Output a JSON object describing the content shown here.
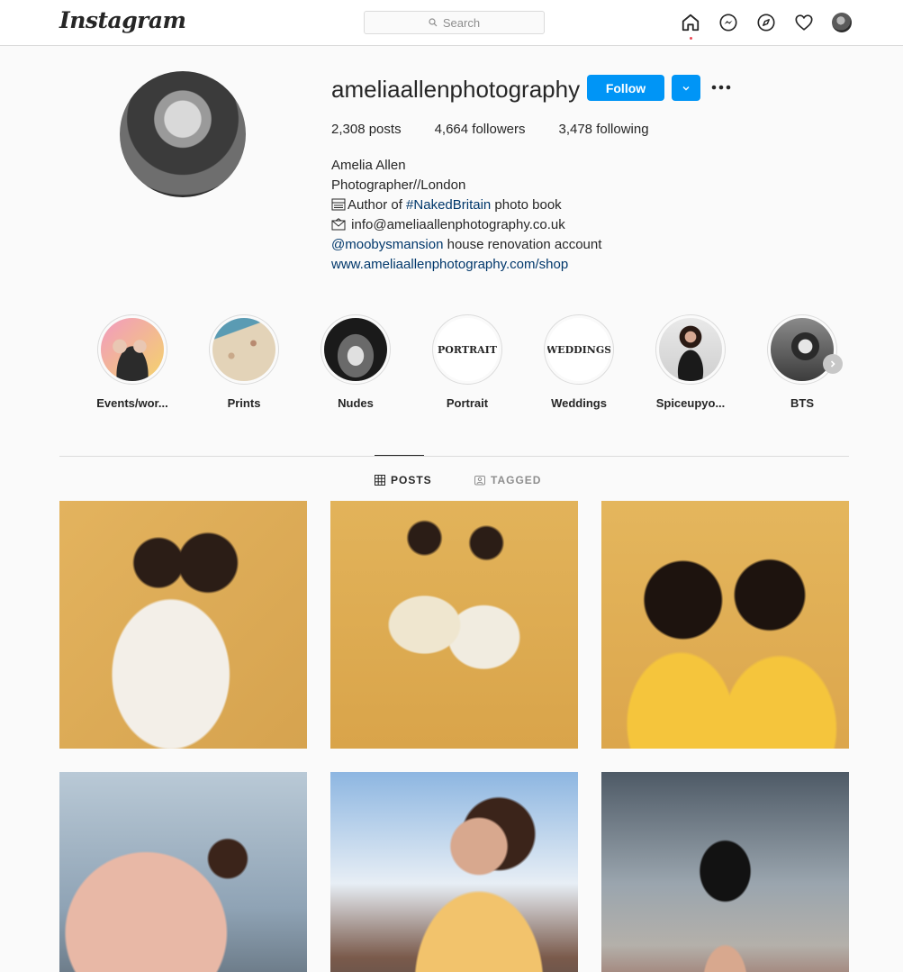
{
  "app": {
    "logo": "Instagram"
  },
  "search": {
    "placeholder": "Search"
  },
  "profile": {
    "username": "ameliaallenphotography",
    "follow_label": "Follow",
    "stats": {
      "posts": "2,308",
      "posts_label": "posts",
      "followers": "4,664",
      "followers_label": "followers",
      "following": "3,478",
      "following_label": "following"
    },
    "full_name": "Amelia Allen",
    "bio_line1": "Photographer//London",
    "bio_line2_prefix": "Author of ",
    "bio_line2_tag": "#NakedBritain",
    "bio_line2_suffix": " photo book",
    "bio_line3": "info@ameliaallenphotography.co.uk",
    "bio_line4_mention": "@moobysmansion",
    "bio_line4_suffix": " house renovation account",
    "website": "www.ameliaallenphotography.com/shop"
  },
  "highlights": [
    {
      "label": "Events/wor...",
      "cover_text": ""
    },
    {
      "label": "Prints",
      "cover_text": ""
    },
    {
      "label": "Nudes",
      "cover_text": ""
    },
    {
      "label": "Portrait",
      "cover_text": "PORTRAIT"
    },
    {
      "label": "Weddings",
      "cover_text": "WEDDINGS"
    },
    {
      "label": "Spiceupyo...",
      "cover_text": ""
    },
    {
      "label": "BTS",
      "cover_text": ""
    }
  ],
  "tabs": {
    "posts": "POSTS",
    "tagged": "TAGGED"
  },
  "colors": {
    "accent": "#0095f6",
    "link": "#00376b",
    "border": "#dbdbdb"
  },
  "icons": [
    "home-icon",
    "messenger-icon",
    "explore-icon",
    "heart-icon",
    "search-icon",
    "chevron-down-icon",
    "more-icon",
    "grid-icon",
    "tagged-icon",
    "chevron-right-icon"
  ]
}
